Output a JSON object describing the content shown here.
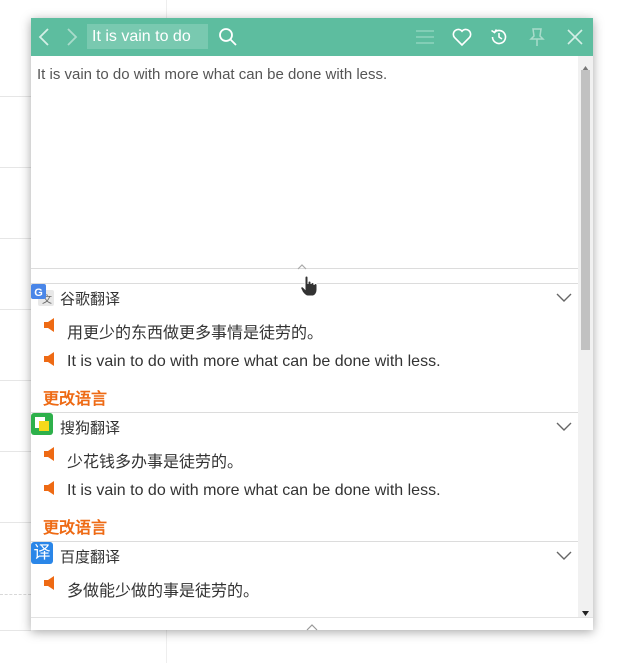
{
  "titlebar": {
    "query": "It is vain to do",
    "icons": [
      "back-icon",
      "forward-icon",
      "search-icon",
      "menu-icon",
      "favorite-icon",
      "history-icon",
      "pin-icon",
      "close-icon"
    ],
    "bg_color": "#5dbd9f"
  },
  "input": {
    "text": "It is vain to do with more what can be done with less."
  },
  "sections": [
    {
      "title": "谷歌翻译",
      "logo": "google-translate-icon",
      "lines": [
        "用更少的东西做更多事情是徒劳的。",
        "It is vain to do with more what can be done with less."
      ],
      "change_language": "更改语言"
    },
    {
      "title": "搜狗翻译",
      "logo": "sogou-translate-icon",
      "lines": [
        "少花钱多办事是徒劳的。",
        "It is vain to do with more what can be done with less."
      ],
      "change_language": "更改语言"
    },
    {
      "title": "百度翻译",
      "logo": "baidu-translate-icon",
      "logo_glyph": "译",
      "lines": [
        "多做能少做的事是徒劳的。"
      ]
    }
  ],
  "colors": {
    "accent": "#5dbd9f",
    "link": "#ee6a14",
    "speaker": "#ee6a14"
  }
}
